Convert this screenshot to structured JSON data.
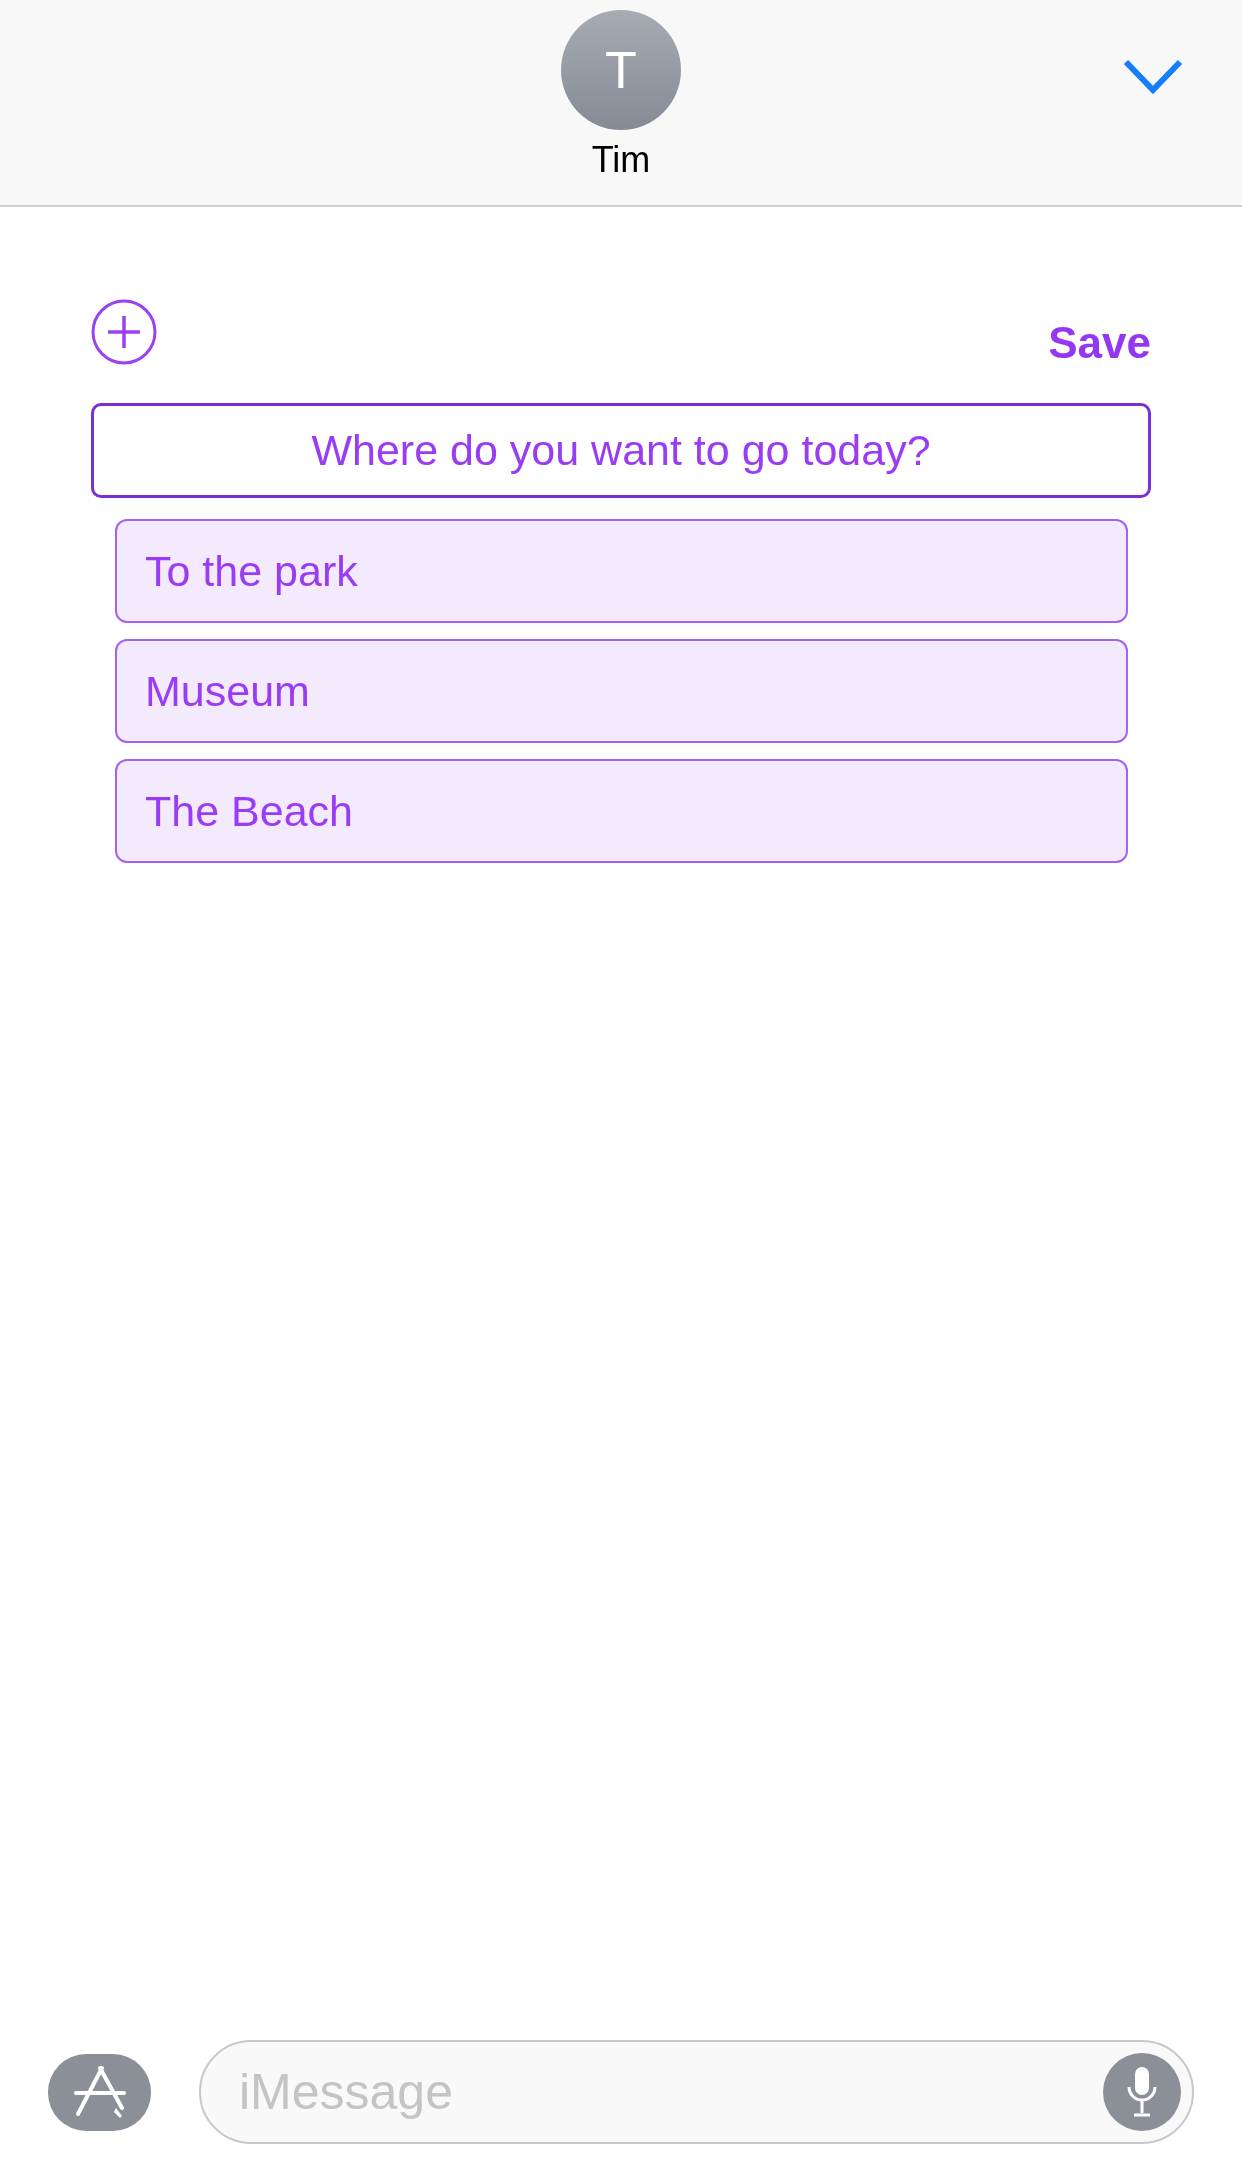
{
  "header": {
    "avatar_initial": "T",
    "contact_name": "Tim"
  },
  "poll": {
    "save_label": "Save",
    "question": "Where do you want to go today?",
    "options": [
      {
        "label": "To the park"
      },
      {
        "label": "Museum"
      },
      {
        "label": "The Beach"
      }
    ]
  },
  "compose": {
    "placeholder": "iMessage"
  }
}
